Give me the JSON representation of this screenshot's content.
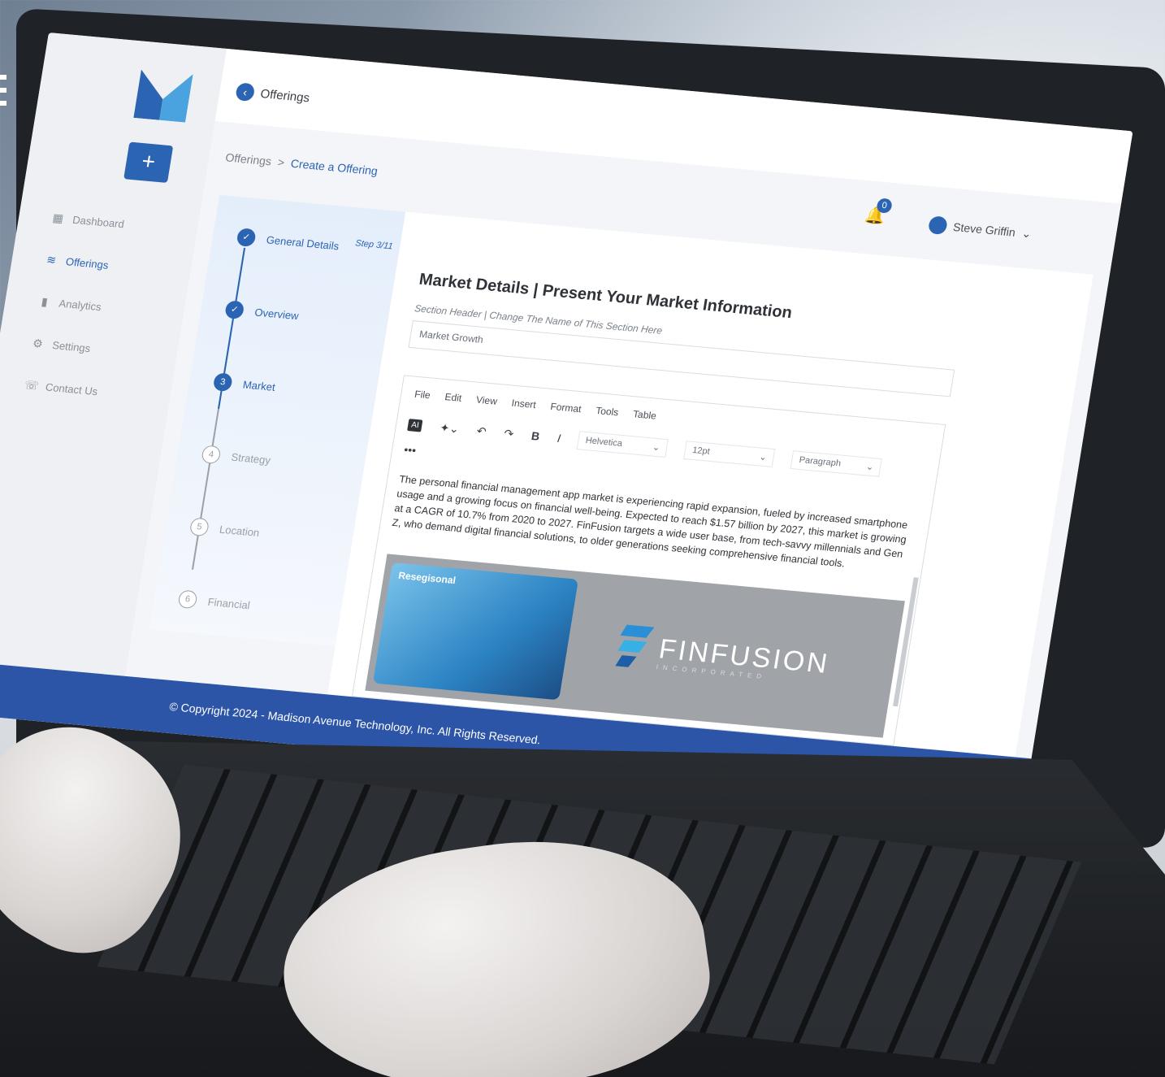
{
  "app": {
    "nav_back_label": "Offerings",
    "add_button_label": "+",
    "sidebar": [
      {
        "label": "Dashboard",
        "icon": "grid-icon"
      },
      {
        "label": "Offerings",
        "icon": "layers-icon"
      },
      {
        "label": "Analytics",
        "icon": "bar-chart-icon"
      },
      {
        "label": "Settings",
        "icon": "gear-icon"
      },
      {
        "label": "Contact Us",
        "icon": "phone-icon"
      }
    ],
    "breadcrumb": {
      "root": "Offerings",
      "sep": ">",
      "current": "Create a Offering"
    },
    "notifications": {
      "count": "0"
    },
    "user": {
      "name": "Steve Griffin"
    }
  },
  "stepper": {
    "step_count": "Step 3/11",
    "steps": [
      {
        "num": "1",
        "label": "General Details",
        "state": "done"
      },
      {
        "num": "2",
        "label": "Overview",
        "state": "done"
      },
      {
        "num": "3",
        "label": "Market",
        "state": "current"
      },
      {
        "num": "4",
        "label": "Strategy",
        "state": "todo"
      },
      {
        "num": "5",
        "label": "Location",
        "state": "todo"
      },
      {
        "num": "6",
        "label": "Financial",
        "state": "todo"
      }
    ]
  },
  "form": {
    "title": "Market Details | Present Your Market Information",
    "subtitle": "Section Header | Change The Name of This Section Here",
    "section_value": "Market Growth",
    "menu": [
      "File",
      "Edit",
      "View",
      "Insert",
      "Format",
      "Tools",
      "Table"
    ],
    "toolbar": {
      "ai": "AI",
      "font": "Helvetica",
      "size": "12pt",
      "block": "Paragraph"
    },
    "more": "•••",
    "body": "The personal financial management app market is experiencing rapid expansion, fueled by increased smartphone usage and a growing focus on financial well-being. Expected to reach $1.57 billion by 2027, this market is growing at a CAGR of 10.7% from 2020 to 2027. FinFusion targets a wide user base, from tech-savvy millennials and Gen Z, who demand digital financial solutions, to older generations seeking comprehensive financial tools.",
    "promo_tag": "Resegisonal",
    "brand": {
      "word": "FINFUSION",
      "tag": "INCORPORATED"
    }
  },
  "footer": "© Copyright 2024 - Madison Avenue Technology, Inc. All Rights Reserved.",
  "colors": {
    "accent": "#2c64b4",
    "footer": "#2c55a8"
  }
}
